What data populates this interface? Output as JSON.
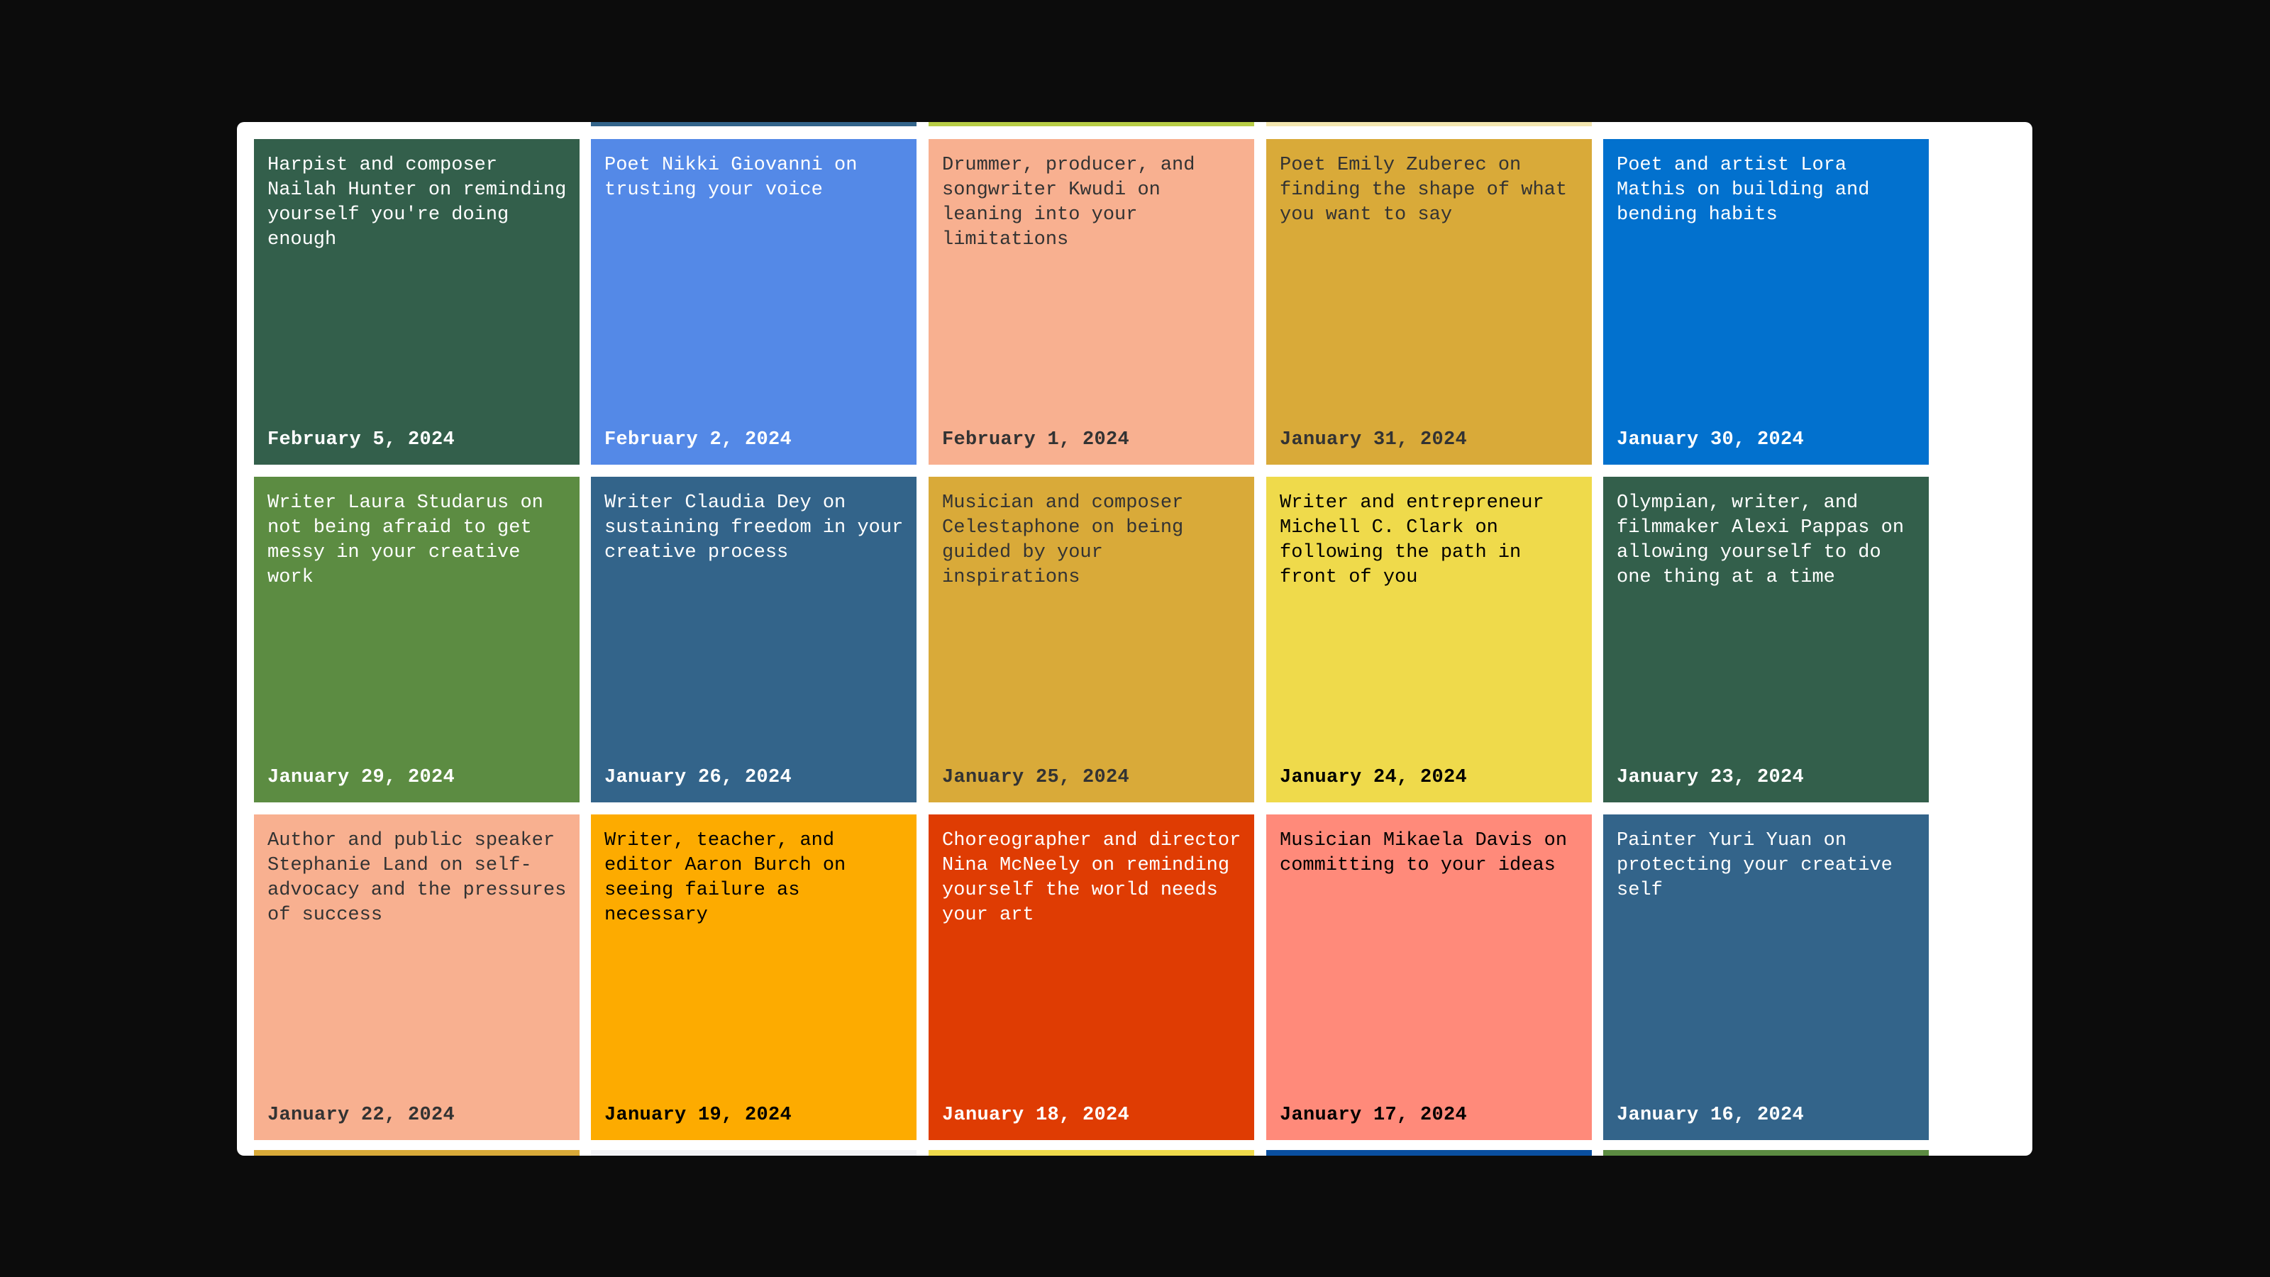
{
  "cards": [
    {
      "title": "Harpist and composer Nailah Hunter on reminding yourself you're doing enough",
      "date": "February 5, 2024",
      "bg": "#335f4b",
      "fg": "#ffffff"
    },
    {
      "title": "Poet Nikki Giovanni on trusting your voice",
      "date": "February 2, 2024",
      "bg": "#5489e7",
      "fg": "#ffffff"
    },
    {
      "title": "Drummer, producer, and songwriter Kwudi on leaning into your limitations",
      "date": "February 1, 2024",
      "bg": "#f8b090",
      "fg": "#333333"
    },
    {
      "title": "Poet Emily Zuberec on finding the shape of what you want to say",
      "date": "January 31, 2024",
      "bg": "#d9aa39",
      "fg": "#333333"
    },
    {
      "title": "Poet and artist Lora Mathis on building and bending habits",
      "date": "January 30, 2024",
      "bg": "#0271ce",
      "fg": "#ffffff"
    },
    {
      "title": "Writer Laura Studarus on not being afraid to get messy in your creative work",
      "date": "January 29, 2024",
      "bg": "#5c8c42",
      "fg": "#ffffff"
    },
    {
      "title": "Writer Claudia Dey on sustaining freedom in your creative process",
      "date": "January 26, 2024",
      "bg": "#33648a",
      "fg": "#ffffff"
    },
    {
      "title": "Musician and composer Celestaphone on being guided by your inspirations",
      "date": "January 25, 2024",
      "bg": "#d9aa39",
      "fg": "#333333"
    },
    {
      "title": "Writer and entrepreneur Michell C. Clark on following the path in front of you",
      "date": "January 24, 2024",
      "bg": "#efda4b",
      "fg": "#000000"
    },
    {
      "title": "Olympian, writer, and filmmaker Alexi Pappas on allowing yourself to do one thing at a time",
      "date": "January 23, 2024",
      "bg": "#335f4b",
      "fg": "#ffffff"
    },
    {
      "title": "Author and public speaker Stephanie Land on self-advocacy and the pressures of success",
      "date": "January 22, 2024",
      "bg": "#f8b090",
      "fg": "#333333"
    },
    {
      "title": "Writer, teacher, and editor Aaron Burch on seeing failure as necessary",
      "date": "January 19, 2024",
      "bg": "#fdab00",
      "fg": "#000000"
    },
    {
      "title": "Choreographer and director Nina McNeely on reminding yourself the world needs your art",
      "date": "January 18, 2024",
      "bg": "#df3c03",
      "fg": "#ffffff"
    },
    {
      "title": "Musician Mikaela Davis on committing to your ideas",
      "date": "January 17, 2024",
      "bg": "#ff8a7a",
      "fg": "#000000"
    },
    {
      "title": "Painter Yuri Yuan on protecting your creative self",
      "date": "January 16, 2024",
      "bg": "#33648a",
      "fg": "#ffffff"
    }
  ],
  "top_strip_colors": [
    "#ffffff",
    "#33648a",
    "#b8cd46",
    "#f3e6b0",
    "#ffffff"
  ],
  "bottom_strip_colors": [
    "#d9aa39",
    "#f3f3f6",
    "#efda4b",
    "#0a4fa0",
    "#5c8c42"
  ]
}
